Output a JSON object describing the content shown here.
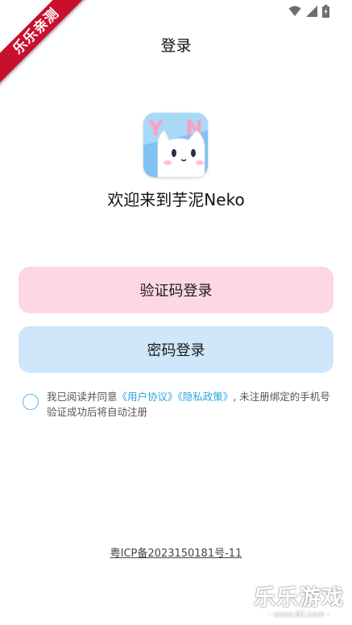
{
  "watermark_badge": "乐乐亲测",
  "header": {
    "title": "登录"
  },
  "app": {
    "welcome": "欢迎来到芋泥Neko",
    "logo_letters": "YN"
  },
  "buttons": {
    "sms_login": "验证码登录",
    "password_login": "密码登录"
  },
  "agreement": {
    "prefix": "我已阅读并同意",
    "user_agreement": "《用户协议》",
    "privacy_policy": "《隐私政策》",
    "suffix": ", 未注册绑定的手机号验证成功后将自动注册"
  },
  "footer": {
    "icp": "粤ICP备2023150181号-11"
  },
  "watermark": {
    "main": "乐乐游戏",
    "sub": "- www.6ll.com -"
  },
  "colors": {
    "sms_button": "#fdd8e2",
    "password_button": "#cfe6fb",
    "link": "#2aa7e0",
    "radio_border": "#58b8ec",
    "badge": "#c8102e"
  },
  "status_icons": [
    "wifi-icon",
    "signal-icon",
    "battery-icon"
  ]
}
